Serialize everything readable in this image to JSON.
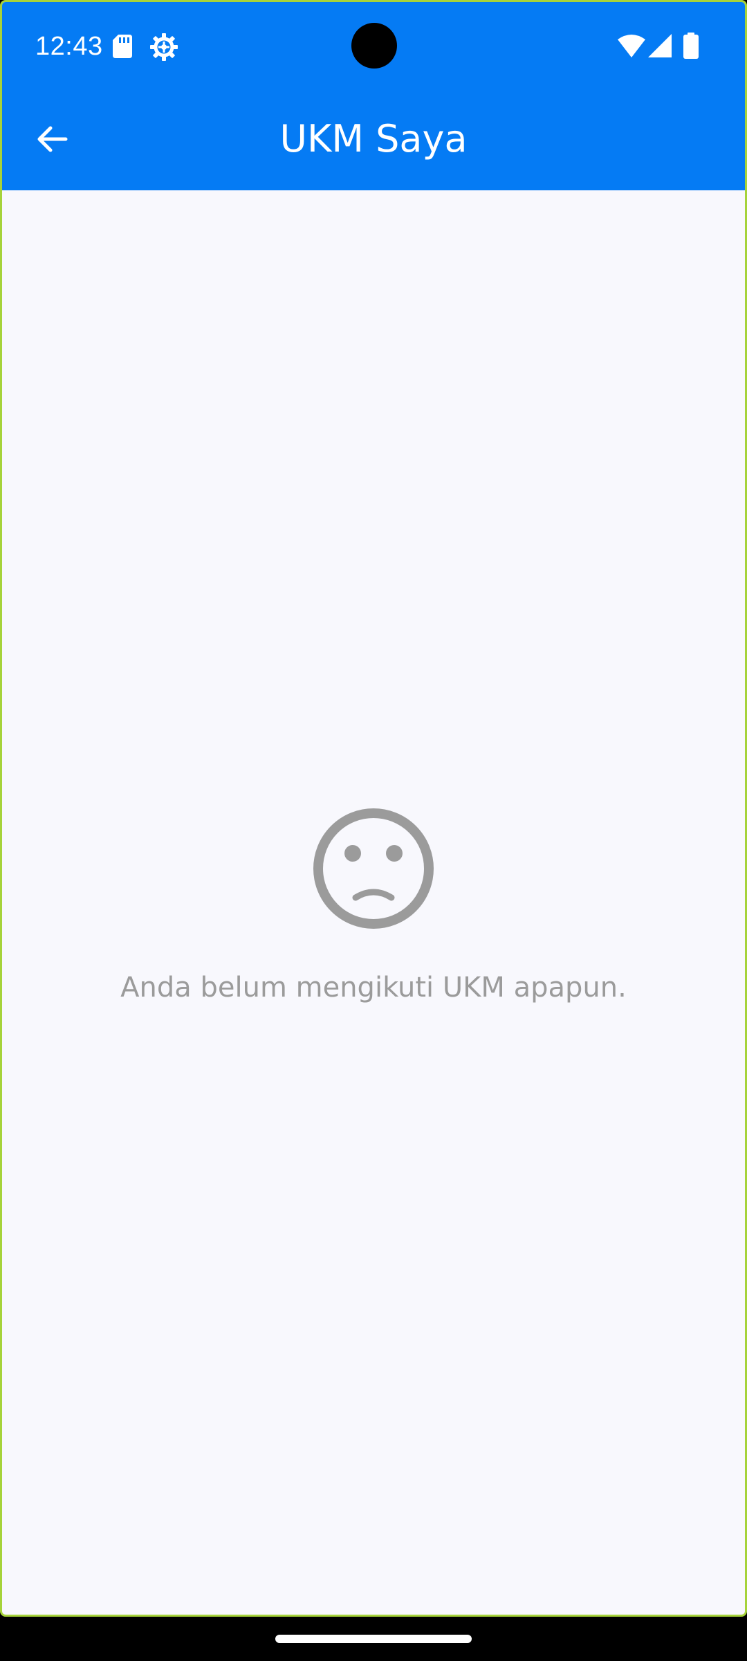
{
  "status_bar": {
    "time": "12:43",
    "icons": [
      "sd-card-icon",
      "settings-gear-icon",
      "wifi-icon",
      "cellular-signal-icon",
      "battery-icon"
    ]
  },
  "app_bar": {
    "title": "UKM Saya",
    "back_icon": "arrow-back-icon",
    "background_color": "#057BF4"
  },
  "empty_state": {
    "icon": "sad-face-icon",
    "message": "Anda belum mengikuti UKM apapun.",
    "color": "#9B9B9B"
  },
  "colors": {
    "page_background": "#F8F8FD",
    "frame_border": "#A6D33A"
  }
}
